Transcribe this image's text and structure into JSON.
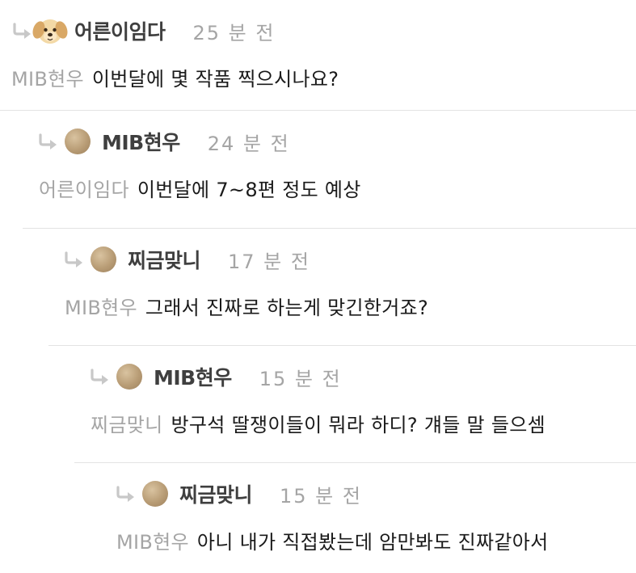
{
  "comments": [
    {
      "author": "어른이임다",
      "avatar": "puppy",
      "time": "25 분 전",
      "mention": "MIB현우",
      "text": "이번달에 몇 작품 찍으시나요?"
    },
    {
      "author": "MIB현우",
      "avatar": "plain",
      "time": "24 분 전",
      "mention": "어른이임다",
      "text": "이번달에 7~8편 정도 예상"
    },
    {
      "author": "찌금맞니",
      "avatar": "plain",
      "time": "17 분 전",
      "mention": "MIB현우",
      "text": "그래서 진짜로 하는게 맞긴한거죠?"
    },
    {
      "author": "MIB현우",
      "avatar": "plain",
      "time": "15 분 전",
      "mention": "찌금맞니",
      "text": "방구석 딸쟁이들이 뭐라 하디? 걔들 말 들으셈"
    },
    {
      "author": "찌금맞니",
      "avatar": "plain",
      "time": "15 분 전",
      "mention": "MIB현우",
      "text": "아니 내가 직접봤는데 암만봐도 진짜같아서"
    }
  ],
  "colors": {
    "divider": "#e3e3e3",
    "muted": "#a5a5a5",
    "author": "#3f3f3f",
    "text": "#1a1a1a"
  },
  "icons": {
    "reply": "reply-arrow-icon",
    "avatar": "avatar-circle",
    "puppy": "puppy-avatar"
  }
}
